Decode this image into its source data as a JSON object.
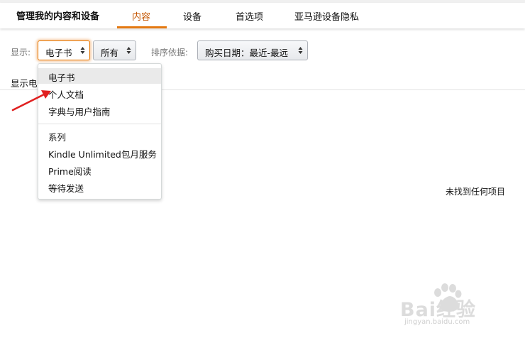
{
  "header": {
    "title": "管理我的内容和设备",
    "tabs": [
      {
        "label": "内容",
        "active": true
      },
      {
        "label": "设备",
        "active": false
      },
      {
        "label": "首选项",
        "active": false
      },
      {
        "label": "亚马逊设备隐私",
        "active": false
      }
    ]
  },
  "filters": {
    "show_label": "显示:",
    "type_select": "电子书",
    "scope_select": "所有",
    "sort_label": "排序依据:",
    "sort_select": "购买日期：最近-最远"
  },
  "dropdown": {
    "group1": [
      "电子书",
      "个人文档",
      "字典与用户指南"
    ],
    "group2": [
      "系列",
      "Kindle Unlimited包月服务",
      "Prime阅读",
      "等待发送"
    ],
    "highlighted_index": 0
  },
  "content": {
    "display_text": "显示电",
    "empty_message": "未找到任何项目"
  },
  "watermark": {
    "logo_text": "Bai经验",
    "url": "jingyan.baidu.com"
  },
  "colors": {
    "accent": "#e47911",
    "annotation_arrow": "#e02020"
  },
  "icons": [
    "sort-arrows-icon",
    "annotation-arrow-icon",
    "baidu-paw-icon"
  ]
}
